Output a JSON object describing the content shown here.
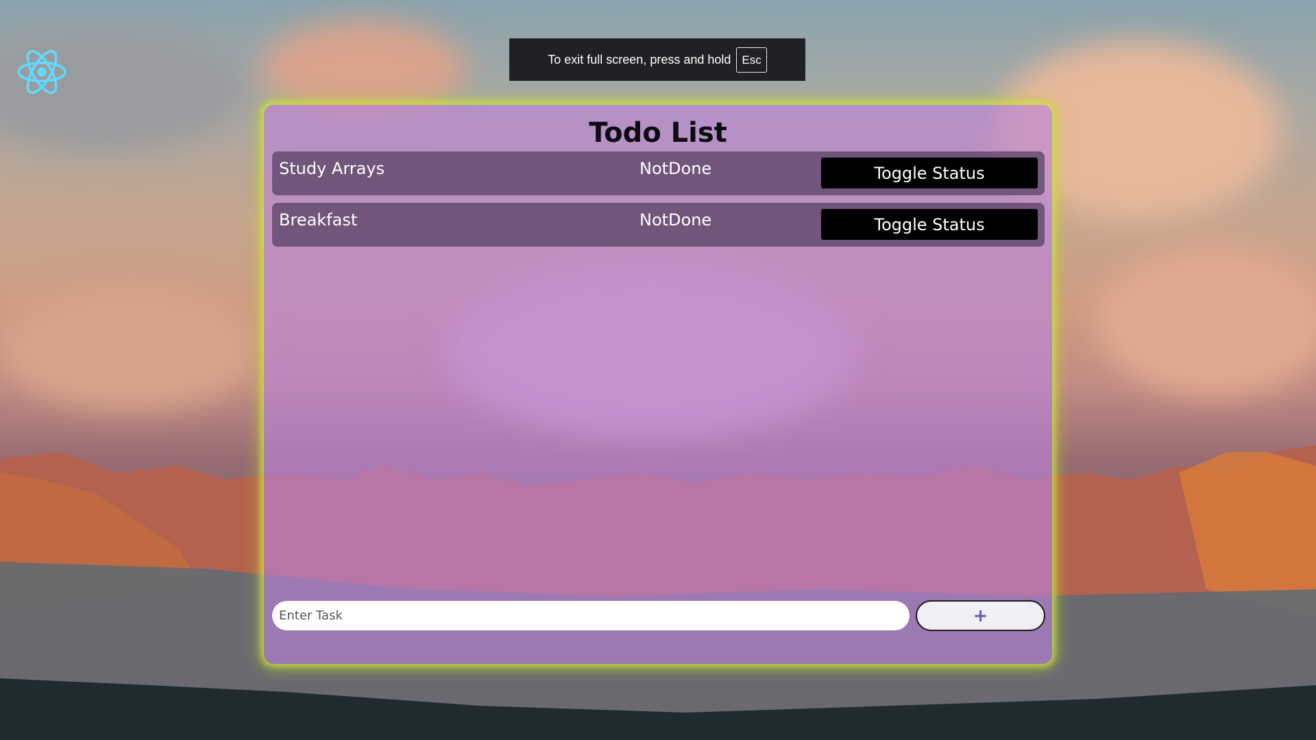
{
  "fullscreen_notice": {
    "message": "To exit full screen, press and hold",
    "key_label": "Esc"
  },
  "todo": {
    "title": "Todo List",
    "items": [
      {
        "name": "Study Arrays",
        "status": "NotDone",
        "toggle_label": "Toggle Status"
      },
      {
        "name": "Breakfast",
        "status": "NotDone",
        "toggle_label": "Toggle Status"
      }
    ],
    "input_placeholder": "Enter Task",
    "add_label": "+"
  },
  "icons": {
    "app_logo": "react-logo-icon",
    "add": "plus-icon"
  },
  "colors": {
    "card_glow": "#cde63c",
    "logo": "#61dafb",
    "toggle_button_bg": "#000000",
    "add_button_text": "#6a5bb0"
  }
}
